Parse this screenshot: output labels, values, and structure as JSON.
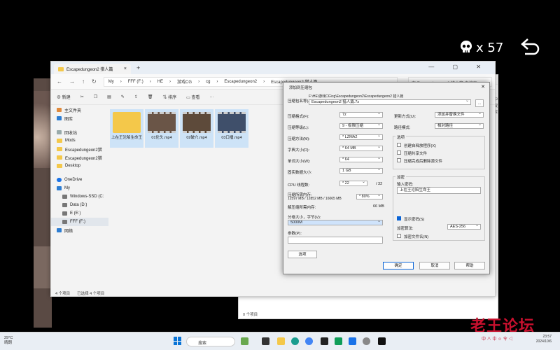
{
  "hud": {
    "count": "x 57"
  },
  "win2": {
    "search": "p 中搜索",
    "status": "0 个项目"
  },
  "explorer": {
    "tab_title": "Escapedungeon2 猎人篇",
    "crumbs": [
      "My",
      "FFF (F:)",
      "HE",
      "游戏CG",
      "cg",
      "Escapedungeon2",
      "Escapedungeon2 猎人篇"
    ],
    "search_placeholder": "在 Escapedungeon2 猎人篇 中搜索",
    "cmd": {
      "new": "新建",
      "sort": "排序",
      "view": "查看"
    },
    "nav": [
      "主文件夹",
      "图库",
      "回收站",
      "Mods",
      "Escapedungeon2猎",
      "Escapedungeon2猎",
      "Desktop",
      "OneDrive",
      "My",
      "Windows-SSD (C:",
      "Data (D:)",
      "E (E:)",
      "FFF (F:)",
      "网络"
    ],
    "files": [
      {
        "name": "上在王沦陷生命王"
      },
      {
        "name": "01伦头.mp4"
      },
      {
        "name": "02破穴.mp4"
      },
      {
        "name": "03口播.mp4"
      }
    ],
    "status_count": "4 个项目",
    "status_sel": "已选择 4 个项目"
  },
  "dialog": {
    "title": "添加到压缩包",
    "path_hint": "F:\\HE\\游戏CG\\cg\\Escapedungeon2\\Escapedungeon2 猎人篇",
    "archive_label": "压缩包名称(A):",
    "archive_value": "Escapedungeon2 猎人篇.7z",
    "browse": "...",
    "rows": [
      {
        "label": "压缩格式(F):",
        "value": "7z"
      },
      {
        "label": "压缩等级(L):",
        "value": "9 - 极限压缩"
      },
      {
        "label": "压缩方法(M):",
        "value": "* LZMA2"
      },
      {
        "label": "字典大小(D):",
        "value": "* 64 MB"
      },
      {
        "label": "单词大小(W):",
        "value": "* 64"
      },
      {
        "label": "固实数据大小:",
        "value": "1 GB"
      },
      {
        "label": "CPU 线程数:",
        "value": "* 22"
      }
    ],
    "cpu_total": "/ 32",
    "mem_label": "压缩所需内存:",
    "mem_detail": "12597 MB / 12852 MB / 16065 MB",
    "mem_pct": "* 80%",
    "decomp_label": "解压缩所需内存:",
    "decomp_value": "66 MB",
    "split_label": "分卷大小，字节(V):",
    "split_value": "5000M",
    "params_label": "参数(P):",
    "options_btn": "选项",
    "update_label": "更新方式(U):",
    "update_value": "添加并替换文件",
    "path_mode_label": "路径模式:",
    "path_mode_value": "相对路径",
    "opt_title": "选项",
    "opts": [
      "创建自释放程序(X)",
      "压缩共享文件",
      "压缩完成后删除源文件"
    ],
    "enc_title": "加密",
    "pwd_label": "输入密码:",
    "pwd_value": "上在王沦陷生命王",
    "show_pwd": "显示密码(S)",
    "enc_method_label": "加密算法:",
    "enc_method_value": "AES-256",
    "enc_names": "加密文件名(N)",
    "ok": "确定",
    "cancel": "取消",
    "help": "帮助"
  },
  "taskbar": {
    "weather_temp": "29°C",
    "weather_desc": "晴朗",
    "search": "搜索",
    "tray": "中 ∧ 中 ☺ 令 ◁",
    "time": "23:57",
    "date": "2024/10/6"
  },
  "watermark": "老王论坛"
}
